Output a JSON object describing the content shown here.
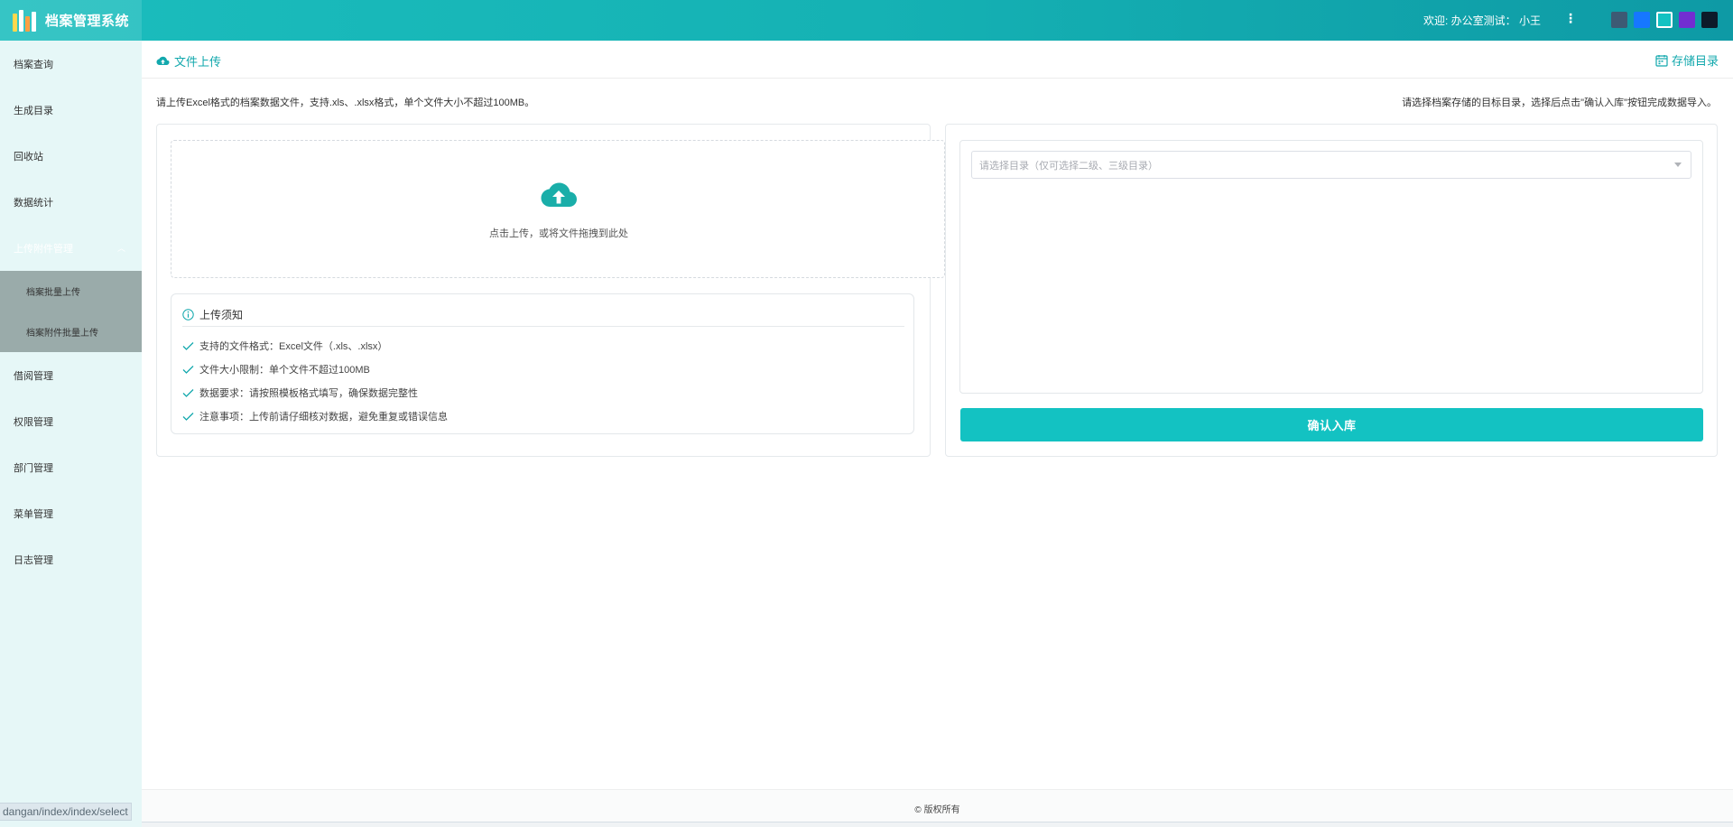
{
  "header": {
    "app_title": "档案管理系统",
    "welcome_text": "欢迎: 办公室测试： 小王",
    "more_icon": "⋮",
    "theme_colors": [
      "#3d5a74",
      "#1677ff",
      "#13c2c2",
      "#722ed1",
      "#0d1b2a"
    ],
    "active_theme": "#13c2c2"
  },
  "sidebar": {
    "items": [
      {
        "label": "档案查询"
      },
      {
        "label": "生成目录"
      },
      {
        "label": "回收站"
      },
      {
        "label": "数据统计"
      }
    ],
    "active_group": {
      "label": "上传附件管理",
      "children": [
        {
          "label": "档案批量上传"
        },
        {
          "label": "档案附件批量上传"
        }
      ]
    },
    "items_after": [
      {
        "label": "借阅管理"
      },
      {
        "label": "权限管理"
      },
      {
        "label": "部门管理"
      },
      {
        "label": "菜单管理"
      },
      {
        "label": "日志管理"
      }
    ],
    "status_url": "dangan/index/index/select"
  },
  "topbar": {
    "title": "文件上传",
    "right_link": "存储目录"
  },
  "hints": {
    "left": "请上传Excel格式的档案数据文件，支持.xls、.xlsx格式，单个文件大小不超过100MB。",
    "right": "请选择档案存储的目标目录，选择后点击\"确认入库\"按钮完成数据导入。"
  },
  "dropzone": {
    "text": "点击上传，或将文件拖拽到此处"
  },
  "notice": {
    "title": "上传须知",
    "items": [
      "支持的文件格式：Excel文件（.xls、.xlsx）",
      "文件大小限制：单个文件不超过100MB",
      "数据要求：请按照模板格式填写，确保数据完整性",
      "注意事项：上传前请仔细核对数据，避免重复或错误信息"
    ]
  },
  "directory_select": {
    "placeholder": "请选择目录（仅可选择二级、三级目录）"
  },
  "confirm_button": "确认入库",
  "footer": {
    "copyright": "© 版权所有"
  },
  "colors": {
    "accent": "#13c2c2",
    "header_start": "#1bbdbd",
    "header_end": "#0e9aa5",
    "sidebar_bg": "#e6f7f7",
    "submenu_bg": "#9aabaa"
  }
}
